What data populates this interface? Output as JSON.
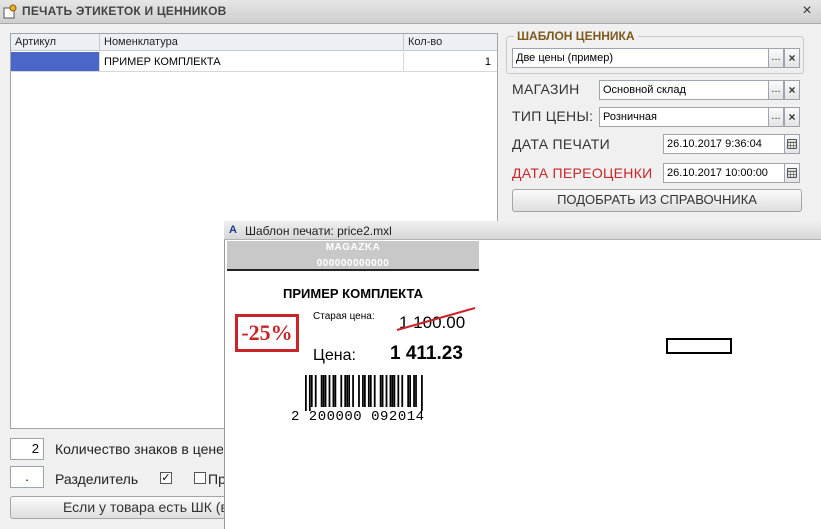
{
  "window": {
    "title": "ПЕЧАТЬ ЭТИКЕТОК И ЦЕННИКОВ",
    "close": "×"
  },
  "table": {
    "columns": [
      "Артикул",
      "Номенклатура",
      "Кол-во"
    ],
    "rows": [
      {
        "article": "",
        "name": "ПРИМЕР КОМПЛЕКТА",
        "qty": "1"
      }
    ]
  },
  "template": {
    "caption": "ШАБЛОН ЦЕННИКА",
    "value": "Две цены (пример)"
  },
  "form": {
    "store_label": "МАГАЗИН",
    "store_value": "Основной склад",
    "price_type_label": "ТИП ЦЕНЫ:",
    "price_type_value": "Розничная",
    "print_date_label": "ДАТА ПЕЧАТИ",
    "print_date_value": "26.10.2017  9:36:04",
    "reprice_date_label": "ДАТА ПЕРЕОЦЕНКИ",
    "reprice_date_value": "26.10.2017 10:00:00",
    "pick_button": "ПОДОБРАТЬ ИЗ СПРАВОЧНИКА",
    "ellipsis": "...",
    "clear": "×"
  },
  "bottom": {
    "digits_value": "2",
    "digits_label": "Количество знаков в цене",
    "separator_value": ".",
    "separator_label": "Разделитель",
    "checkbox1_mark": "✓",
    "checkbox2_label": "Пр",
    "barcode_button": "Если у товара есть ШК (в"
  },
  "preview": {
    "title": "Шаблон печати: price2.mxl",
    "icon_letter": "A",
    "shop": "MAGAZKA",
    "shop_code": "000000000000",
    "product": "ПРИМЕР КОМПЛЕКТА",
    "discount": "-25%",
    "old_price_label": "Старая цена:",
    "old_price": "1 100.00",
    "price_label": "Цена:",
    "price": "1 411.23",
    "barcode_text": "2 200000 092014"
  },
  "colors": {
    "accent_red": "#c8252a",
    "caption_brown": "#7b5a1c",
    "selection_blue": "#4a66c9"
  }
}
